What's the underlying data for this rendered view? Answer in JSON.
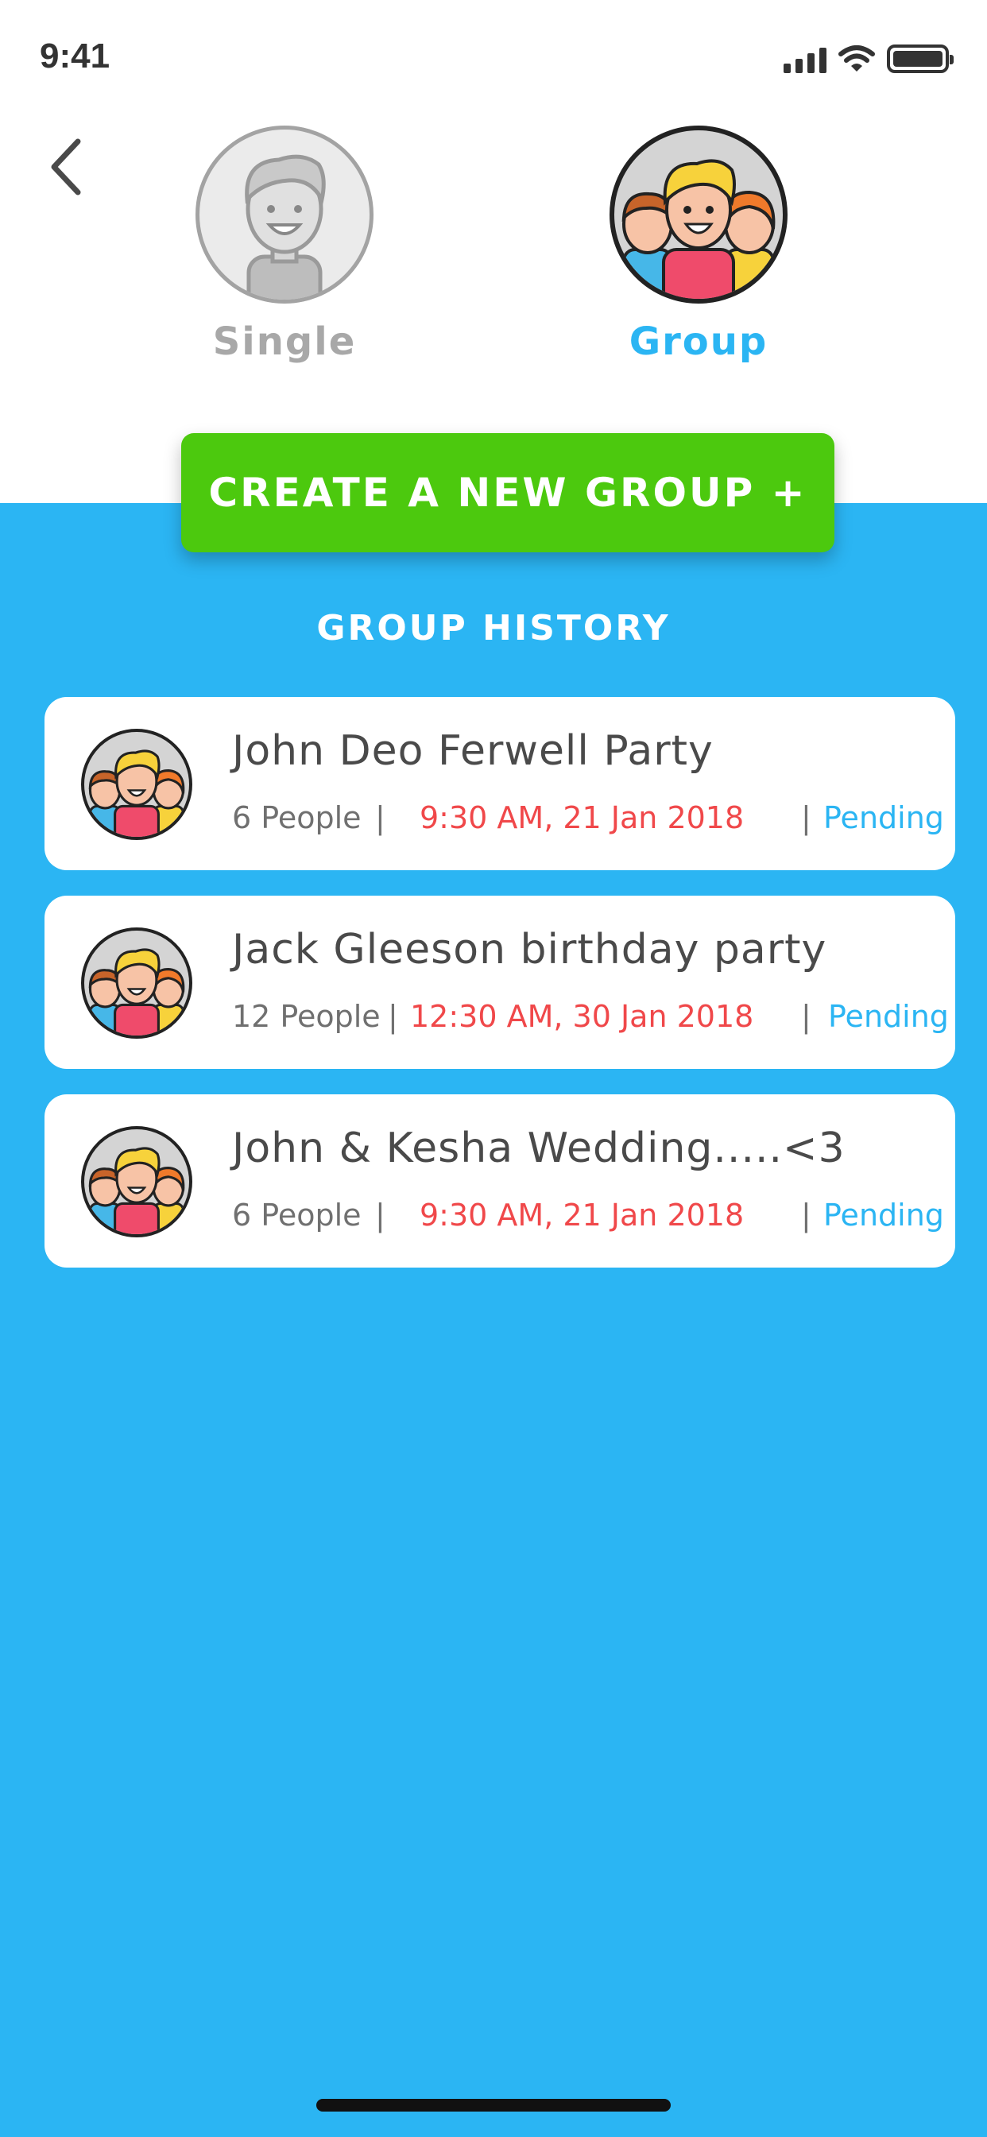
{
  "status_bar": {
    "time": "9:41"
  },
  "modes": {
    "single_label": "Single",
    "group_label": "Group",
    "selected": "Group"
  },
  "create_button": {
    "label": "CREATE A NEW GROUP +"
  },
  "history": {
    "title": "GROUP HISTORY",
    "items": [
      {
        "title": "John Deo Ferwell Party",
        "people": "6 People",
        "datetime": "9:30 AM, 21 Jan 2018",
        "status": "Pending"
      },
      {
        "title": "Jack Gleeson birthday party",
        "people": "12 People",
        "datetime": "12:30 AM, 30 Jan 2018",
        "status": "Pending"
      },
      {
        "title": "John & Kesha Wedding.....<3",
        "people": "6 People",
        "datetime": "9:30 AM, 21 Jan 2018",
        "status": "Pending"
      }
    ]
  },
  "colors": {
    "background_blue": "#2BB5F3",
    "button_green": "#4CC90E",
    "datetime_red": "#F0484A",
    "status_blue": "#2BB5F3"
  }
}
